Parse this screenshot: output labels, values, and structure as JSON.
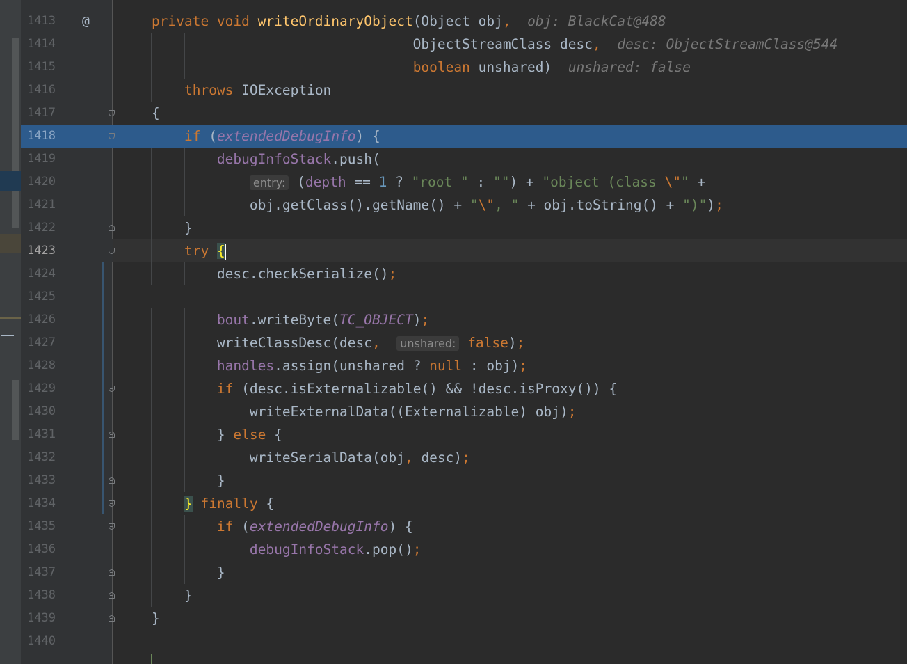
{
  "editor": {
    "caret_line": 1423,
    "execution_line": 1418,
    "override_marker_glyph": "@",
    "colors": {
      "background": "#2b2b2b",
      "gutter": "#313335",
      "execution_highlight": "#2d5b8c",
      "keyword": "#cc7832",
      "method_declaration": "#ffc66d",
      "field": "#9876aa",
      "string": "#6a8759",
      "number": "#6897bb",
      "text": "#a9b7c6",
      "inline_hint": "#787878"
    },
    "lines": [
      {
        "n": "1413",
        "gm": "@",
        "f": "",
        "t": [
          [
            "kw",
            "private "
          ],
          [
            "kw",
            "void "
          ],
          [
            "fn",
            "writeOrdinaryObject"
          ],
          [
            "tx",
            "(Object obj"
          ],
          [
            "kw",
            ","
          ],
          [
            "tx",
            "  "
          ],
          [
            "hint",
            "obj: BlackCat@488"
          ]
        ]
      },
      {
        "n": "1414",
        "gm": "",
        "f": "",
        "t": [
          [
            "tx",
            "                                ObjectStreamClass desc"
          ],
          [
            "kw",
            ","
          ],
          [
            "tx",
            "  "
          ],
          [
            "hint",
            "desc: ObjectStreamClass@544"
          ]
        ]
      },
      {
        "n": "1415",
        "gm": "",
        "f": "",
        "t": [
          [
            "tx",
            "                                "
          ],
          [
            "kw",
            "boolean "
          ],
          [
            "tx",
            "unshared)  "
          ],
          [
            "hint",
            "unshared: false"
          ]
        ]
      },
      {
        "n": "1416",
        "gm": "",
        "f": "",
        "t": [
          [
            "tx",
            "    "
          ],
          [
            "kw",
            "throws "
          ],
          [
            "tx",
            "IOException"
          ]
        ]
      },
      {
        "n": "1417",
        "gm": "",
        "f": "open",
        "t": [
          [
            "tx",
            "{"
          ]
        ]
      },
      {
        "n": "1418",
        "gm": "",
        "f": "open",
        "t": [
          [
            "tx",
            "    "
          ],
          [
            "kw",
            "if "
          ],
          [
            "tx",
            "("
          ],
          [
            "fi",
            "extendedDebugInfo"
          ],
          [
            "tx",
            ") {"
          ]
        ]
      },
      {
        "n": "1419",
        "gm": "",
        "f": "",
        "t": [
          [
            "tx",
            "        "
          ],
          [
            "fld",
            "debugInfoStack"
          ],
          [
            "tx",
            ".push("
          ]
        ]
      },
      {
        "n": "1420",
        "gm": "",
        "f": "",
        "t": [
          [
            "tx",
            "            "
          ],
          [
            "inlay",
            "entry:"
          ],
          [
            "tx",
            " ("
          ],
          [
            "fld",
            "depth "
          ],
          [
            "tx",
            "== "
          ],
          [
            "num",
            "1 "
          ],
          [
            "tx",
            "? "
          ],
          [
            "str",
            "\"root \" "
          ],
          [
            "tx",
            ": "
          ],
          [
            "str",
            "\"\""
          ],
          [
            "tx",
            ") + "
          ],
          [
            "str",
            "\"object (class "
          ],
          [
            "kw",
            "\\\""
          ],
          [
            "str",
            "\" "
          ],
          [
            "tx",
            "+"
          ]
        ]
      },
      {
        "n": "1421",
        "gm": "",
        "f": "",
        "t": [
          [
            "tx",
            "            obj.getClass().getName() + "
          ],
          [
            "str",
            "\""
          ],
          [
            "kw",
            "\\\""
          ],
          [
            "str",
            ", \" "
          ],
          [
            "tx",
            "+ obj.toString() + "
          ],
          [
            "str",
            "\")\""
          ],
          [
            "tx",
            ")"
          ],
          [
            "kw",
            ";"
          ]
        ]
      },
      {
        "n": "1422",
        "gm": "",
        "f": "close",
        "t": [
          [
            "tx",
            "    }"
          ]
        ]
      },
      {
        "n": "1423",
        "gm": "",
        "f": "open",
        "t": [
          [
            "tx",
            "    "
          ],
          [
            "kw",
            "try "
          ],
          [
            "brc",
            "{"
          ],
          [
            "cursor",
            ""
          ]
        ]
      },
      {
        "n": "1424",
        "gm": "",
        "f": "",
        "t": [
          [
            "tx",
            "        desc.checkSerialize()"
          ],
          [
            "kw",
            ";"
          ]
        ]
      },
      {
        "n": "1425",
        "gm": "",
        "f": "",
        "t": []
      },
      {
        "n": "1426",
        "gm": "",
        "f": "",
        "t": [
          [
            "tx",
            "        "
          ],
          [
            "fld",
            "bout"
          ],
          [
            "tx",
            ".writeByte("
          ],
          [
            "fi",
            "TC_OBJECT"
          ],
          [
            "tx",
            ")"
          ],
          [
            "kw",
            ";"
          ]
        ]
      },
      {
        "n": "1427",
        "gm": "",
        "f": "",
        "t": [
          [
            "tx",
            "        writeClassDesc(desc"
          ],
          [
            "kw",
            ", "
          ],
          [
            "tx",
            " "
          ],
          [
            "inlay",
            "unshared:"
          ],
          [
            "tx",
            " "
          ],
          [
            "kw",
            "false"
          ],
          [
            "tx",
            ")"
          ],
          [
            "kw",
            ";"
          ]
        ]
      },
      {
        "n": "1428",
        "gm": "",
        "f": "",
        "t": [
          [
            "tx",
            "        "
          ],
          [
            "fld",
            "handles"
          ],
          [
            "tx",
            ".assign(unshared ? "
          ],
          [
            "kw",
            "null "
          ],
          [
            "tx",
            ": obj)"
          ],
          [
            "kw",
            ";"
          ]
        ]
      },
      {
        "n": "1429",
        "gm": "",
        "f": "open",
        "t": [
          [
            "tx",
            "        "
          ],
          [
            "kw",
            "if "
          ],
          [
            "tx",
            "(desc.isExternalizable() && !desc.isProxy()) {"
          ]
        ]
      },
      {
        "n": "1430",
        "gm": "",
        "f": "",
        "t": [
          [
            "tx",
            "            writeExternalData((Externalizable) obj)"
          ],
          [
            "kw",
            ";"
          ]
        ]
      },
      {
        "n": "1431",
        "gm": "",
        "f": "close",
        "t": [
          [
            "tx",
            "        } "
          ],
          [
            "kw",
            "else "
          ],
          [
            "tx",
            "{"
          ]
        ]
      },
      {
        "n": "1432",
        "gm": "",
        "f": "",
        "t": [
          [
            "tx",
            "            writeSerialData(obj"
          ],
          [
            "kw",
            ", "
          ],
          [
            "tx",
            "desc)"
          ],
          [
            "kw",
            ";"
          ]
        ]
      },
      {
        "n": "1433",
        "gm": "",
        "f": "close",
        "t": [
          [
            "tx",
            "        }"
          ]
        ]
      },
      {
        "n": "1434",
        "gm": "",
        "f": "open",
        "t": [
          [
            "tx",
            "    "
          ],
          [
            "brc",
            "}"
          ],
          [
            "tx",
            " "
          ],
          [
            "kw",
            "finally "
          ],
          [
            "tx",
            "{"
          ]
        ]
      },
      {
        "n": "1435",
        "gm": "",
        "f": "open",
        "t": [
          [
            "tx",
            "        "
          ],
          [
            "kw",
            "if "
          ],
          [
            "tx",
            "("
          ],
          [
            "fi",
            "extendedDebugInfo"
          ],
          [
            "tx",
            ") {"
          ]
        ]
      },
      {
        "n": "1436",
        "gm": "",
        "f": "",
        "t": [
          [
            "tx",
            "            "
          ],
          [
            "fld",
            "debugInfoStack"
          ],
          [
            "tx",
            ".pop()"
          ],
          [
            "kw",
            ";"
          ]
        ]
      },
      {
        "n": "1437",
        "gm": "",
        "f": "close",
        "t": [
          [
            "tx",
            "        }"
          ]
        ]
      },
      {
        "n": "1438",
        "gm": "",
        "f": "close",
        "t": [
          [
            "tx",
            "    }"
          ]
        ]
      },
      {
        "n": "1439",
        "gm": "",
        "f": "close",
        "t": [
          [
            "tx",
            "}"
          ]
        ]
      },
      {
        "n": "1440",
        "gm": "",
        "f": "",
        "t": []
      }
    ]
  }
}
